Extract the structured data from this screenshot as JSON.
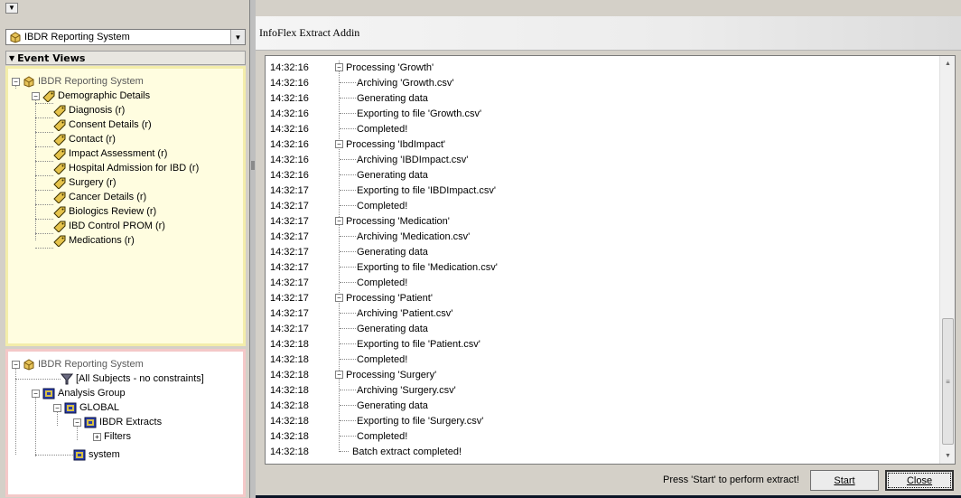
{
  "left_panel": {
    "system_select": {
      "value": "IBDR Reporting System"
    },
    "event_views_label": "Event Views",
    "event_tree": {
      "root": "IBDR Reporting System",
      "group": "Demographic Details",
      "items": [
        "Diagnosis (r)",
        "Consent Details (r)",
        "Contact (r)",
        "Impact Assessment (r)",
        "Hospital Admission for IBD (r)",
        "Surgery (r)",
        "Cancer Details (r)",
        "Biologics Review (r)",
        "IBD Control PROM (r)",
        "Medications (r)"
      ]
    },
    "analysis_tree": {
      "root": "IBDR Reporting System",
      "all_subjects": "[All Subjects - no constraints]",
      "analysis_group": "Analysis Group",
      "global": "GLOBAL",
      "ibdr_extracts": "IBDR Extracts",
      "filters": "Filters",
      "system": "system"
    }
  },
  "dialog": {
    "title": "InfoFlex Extract Addin",
    "log": [
      {
        "time": "14:32:16",
        "msg": "Processing 'Growth'",
        "kind": "proc"
      },
      {
        "time": "14:32:16",
        "msg": "Archiving 'Growth.csv'",
        "kind": "sub"
      },
      {
        "time": "14:32:16",
        "msg": "Generating data",
        "kind": "sub"
      },
      {
        "time": "14:32:16",
        "msg": "Exporting to file 'Growth.csv'",
        "kind": "sub"
      },
      {
        "time": "14:32:16",
        "msg": "Completed!",
        "kind": "sub"
      },
      {
        "time": "14:32:16",
        "msg": "Processing 'IbdImpact'",
        "kind": "proc"
      },
      {
        "time": "14:32:16",
        "msg": "Archiving 'IBDImpact.csv'",
        "kind": "sub"
      },
      {
        "time": "14:32:16",
        "msg": "Generating data",
        "kind": "sub"
      },
      {
        "time": "14:32:17",
        "msg": "Exporting to file 'IBDImpact.csv'",
        "kind": "sub"
      },
      {
        "time": "14:32:17",
        "msg": "Completed!",
        "kind": "sub"
      },
      {
        "time": "14:32:17",
        "msg": "Processing 'Medication'",
        "kind": "proc"
      },
      {
        "time": "14:32:17",
        "msg": "Archiving 'Medication.csv'",
        "kind": "sub"
      },
      {
        "time": "14:32:17",
        "msg": "Generating data",
        "kind": "sub"
      },
      {
        "time": "14:32:17",
        "msg": "Exporting to file 'Medication.csv'",
        "kind": "sub"
      },
      {
        "time": "14:32:17",
        "msg": "Completed!",
        "kind": "sub"
      },
      {
        "time": "14:32:17",
        "msg": "Processing 'Patient'",
        "kind": "proc"
      },
      {
        "time": "14:32:17",
        "msg": "Archiving 'Patient.csv'",
        "kind": "sub"
      },
      {
        "time": "14:32:17",
        "msg": "Generating data",
        "kind": "sub"
      },
      {
        "time": "14:32:18",
        "msg": "Exporting to file 'Patient.csv'",
        "kind": "sub"
      },
      {
        "time": "14:32:18",
        "msg": "Completed!",
        "kind": "sub"
      },
      {
        "time": "14:32:18",
        "msg": "Processing 'Surgery'",
        "kind": "proc"
      },
      {
        "time": "14:32:18",
        "msg": "Archiving 'Surgery.csv'",
        "kind": "sub"
      },
      {
        "time": "14:32:18",
        "msg": "Generating data",
        "kind": "sub"
      },
      {
        "time": "14:32:18",
        "msg": "Exporting to file 'Surgery.csv'",
        "kind": "sub"
      },
      {
        "time": "14:32:18",
        "msg": "Completed!",
        "kind": "sub"
      },
      {
        "time": "14:32:18",
        "msg": "Batch extract completed!",
        "kind": "done"
      }
    ],
    "status": "Press 'Start' to perform extract!",
    "start_label": "Start",
    "close_label": "Close"
  }
}
